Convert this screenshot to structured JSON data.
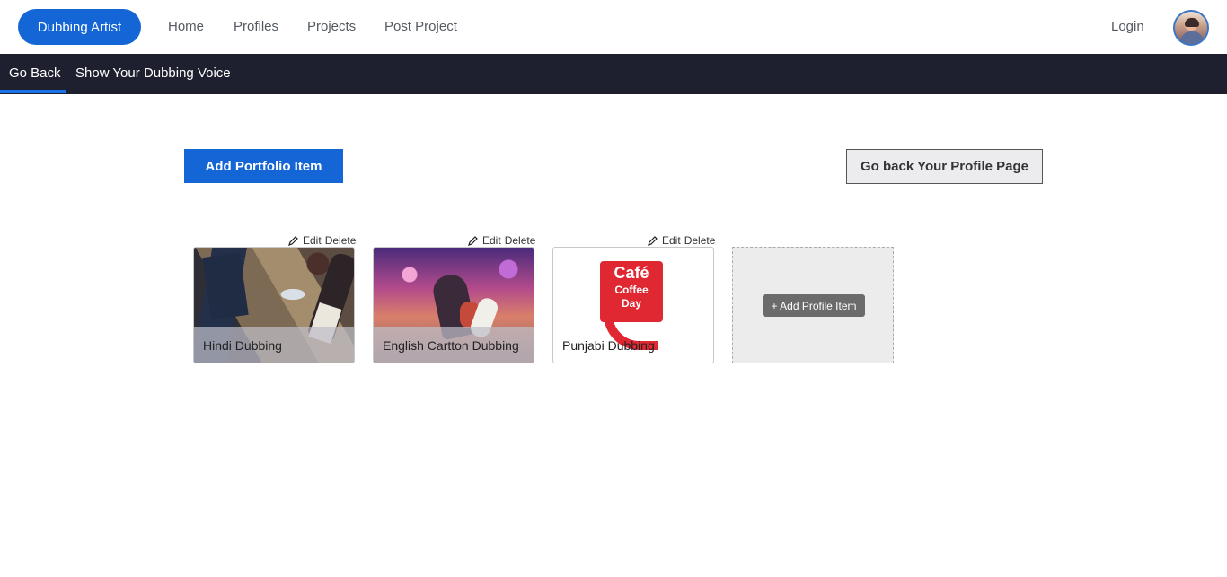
{
  "nav": {
    "brand": "Dubbing Artist",
    "links": [
      "Home",
      "Profiles",
      "Projects",
      "Post Project"
    ],
    "login": "Login"
  },
  "subnav": {
    "tabs": [
      "Go Back",
      "Show Your Dubbing Voice"
    ],
    "active_tab": "Go Back"
  },
  "actions": {
    "add_portfolio": "Add Portfolio Item",
    "go_back_profile": "Go back Your Profile Page"
  },
  "portfolio": {
    "edit_label": "Edit",
    "delete_label": "Delete",
    "items": [
      {
        "caption": "Hindi Dubbing",
        "image": "travel-items-photo"
      },
      {
        "caption": "English Cartton Dubbing",
        "image": "cartoon-scene-photo"
      },
      {
        "caption": "Punjabi Dubbing",
        "image": "cafe-coffee-day-logo"
      }
    ],
    "add_item_label": "+ Add Profile Item",
    "ccd_logo_text": [
      "Café",
      "Coffee",
      "Day"
    ]
  },
  "colors": {
    "primary": "#1466d6",
    "subbar": "#1e1f2f",
    "active_underline": "#1a73e8"
  }
}
